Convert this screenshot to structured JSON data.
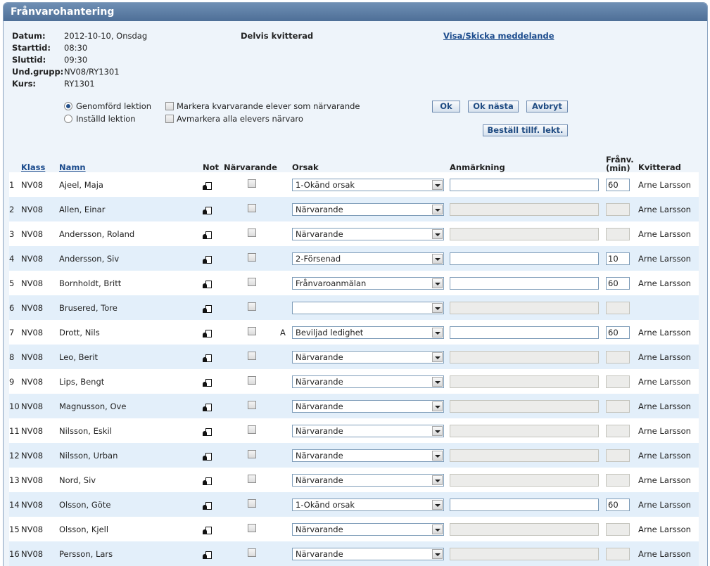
{
  "title": "Frånvarohantering",
  "info": [
    {
      "label": "Datum:",
      "value": "2012-10-10, Onsdag"
    },
    {
      "label": "Starttid:",
      "value": "08:30"
    },
    {
      "label": "Sluttid:",
      "value": "09:30"
    },
    {
      "label": "Und.grupp:",
      "value": "NV08/RY1301"
    },
    {
      "label": "Kurs:",
      "value": "RY1301"
    }
  ],
  "status": "Delvis kvitterad",
  "message_link": "Visa/Skicka meddelande",
  "lesson_options": {
    "done": "Genomförd lektion",
    "cancelled": "Inställd lektion"
  },
  "checkbox_options": {
    "mark_remaining": "Markera kvarvarande elever som närvarande",
    "unmark_all": "Avmarkera alla elevers närvaro"
  },
  "buttons": {
    "ok": "Ok",
    "ok_next": "Ok nästa",
    "cancel": "Avbryt",
    "order": "Beställ tillf. lekt."
  },
  "columns": {
    "klass": "Klass",
    "namn": "Namn",
    "not": "Not",
    "narvarande": "Närvarande",
    "orsak": "Orsak",
    "anmarkning": "Anmärkning",
    "franv": "Frånv. (min)",
    "kvitterad": "Kvitterad"
  },
  "rows": [
    {
      "nr": "1",
      "klass": "NV08",
      "namn": "Ajeel, Maja",
      "flag": "",
      "orsak": "1-Okänd orsak",
      "editable": true,
      "min": "60",
      "kvitterad": "Arne Larsson"
    },
    {
      "nr": "2",
      "klass": "NV08",
      "namn": "Allen, Einar",
      "flag": "",
      "orsak": "Närvarande",
      "editable": false,
      "min": "",
      "kvitterad": "Arne Larsson"
    },
    {
      "nr": "3",
      "klass": "NV08",
      "namn": "Andersson, Roland",
      "flag": "",
      "orsak": "Närvarande",
      "editable": false,
      "min": "",
      "kvitterad": "Arne Larsson"
    },
    {
      "nr": "4",
      "klass": "NV08",
      "namn": "Andersson, Siv",
      "flag": "",
      "orsak": "2-Försenad",
      "editable": true,
      "min": "10",
      "kvitterad": "Arne Larsson"
    },
    {
      "nr": "5",
      "klass": "NV08",
      "namn": "Bornholdt, Britt",
      "flag": "",
      "orsak": "Frånvaroanmälan",
      "editable": true,
      "min": "60",
      "kvitterad": "Arne Larsson"
    },
    {
      "nr": "6",
      "klass": "NV08",
      "namn": "Brusered, Tore",
      "flag": "",
      "orsak": "",
      "editable": false,
      "min": "",
      "kvitterad": ""
    },
    {
      "nr": "7",
      "klass": "NV08",
      "namn": "Drott, Nils",
      "flag": "A",
      "orsak": "Beviljad ledighet",
      "editable": true,
      "min": "60",
      "kvitterad": "Arne Larsson"
    },
    {
      "nr": "8",
      "klass": "NV08",
      "namn": "Leo, Berit",
      "flag": "",
      "orsak": "Närvarande",
      "editable": false,
      "min": "",
      "kvitterad": "Arne Larsson"
    },
    {
      "nr": "9",
      "klass": "NV08",
      "namn": "Lips, Bengt",
      "flag": "",
      "orsak": "Närvarande",
      "editable": false,
      "min": "",
      "kvitterad": "Arne Larsson"
    },
    {
      "nr": "10",
      "klass": "NV08",
      "namn": "Magnusson, Ove",
      "flag": "",
      "orsak": "Närvarande",
      "editable": false,
      "min": "",
      "kvitterad": "Arne Larsson"
    },
    {
      "nr": "11",
      "klass": "NV08",
      "namn": "Nilsson, Eskil",
      "flag": "",
      "orsak": "Närvarande",
      "editable": false,
      "min": "",
      "kvitterad": "Arne Larsson"
    },
    {
      "nr": "12",
      "klass": "NV08",
      "namn": "Nilsson, Urban",
      "flag": "",
      "orsak": "Närvarande",
      "editable": false,
      "min": "",
      "kvitterad": "Arne Larsson"
    },
    {
      "nr": "13",
      "klass": "NV08",
      "namn": "Nord, Siv",
      "flag": "",
      "orsak": "Närvarande",
      "editable": false,
      "min": "",
      "kvitterad": "Arne Larsson"
    },
    {
      "nr": "14",
      "klass": "NV08",
      "namn": "Olsson, Göte",
      "flag": "",
      "orsak": "1-Okänd orsak",
      "editable": true,
      "min": "60",
      "kvitterad": "Arne Larsson"
    },
    {
      "nr": "15",
      "klass": "NV08",
      "namn": "Olsson, Kjell",
      "flag": "",
      "orsak": "Närvarande",
      "editable": false,
      "min": "",
      "kvitterad": "Arne Larsson"
    },
    {
      "nr": "16",
      "klass": "NV08",
      "namn": "Persson, Lars",
      "flag": "",
      "orsak": "Närvarande",
      "editable": false,
      "min": "",
      "kvitterad": "Arne Larsson"
    }
  ]
}
